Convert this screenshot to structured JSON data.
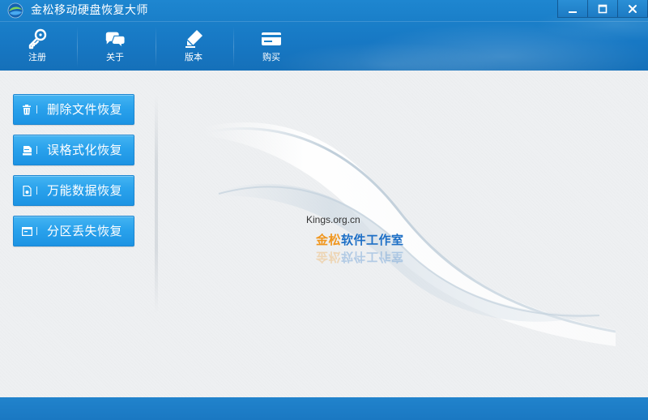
{
  "window": {
    "title": "金松移动硬盘恢复大师"
  },
  "window_controls": {
    "minimize_icon": "minimize-icon",
    "maximize_icon": "maximize-icon",
    "close_icon": "close-icon"
  },
  "toolbar": {
    "items": [
      {
        "label": "注册",
        "icon": "key-icon"
      },
      {
        "label": "关于",
        "icon": "chat-bubbles-icon"
      },
      {
        "label": "版本",
        "icon": "pencil-icon"
      },
      {
        "label": "购买",
        "icon": "card-icon"
      }
    ]
  },
  "sidebar": {
    "buttons": [
      {
        "label": "删除文件恢复",
        "icon": "trash-icon"
      },
      {
        "label": "误格式化恢复",
        "icon": "format-drive-icon"
      },
      {
        "label": "万能数据恢复",
        "icon": "document-icon"
      },
      {
        "label": "分区丢失恢复",
        "icon": "partition-icon"
      }
    ]
  },
  "branding": {
    "site": "Kings.org.cn",
    "studio_part1": "金松",
    "studio_part2": "软件工作室"
  },
  "colors": {
    "header_blue": "#1a7fc9",
    "button_blue": "#2aa2ec",
    "studio_orange": "#f0961e",
    "studio_blue": "#1d6fc6",
    "background": "#eef0f2"
  }
}
